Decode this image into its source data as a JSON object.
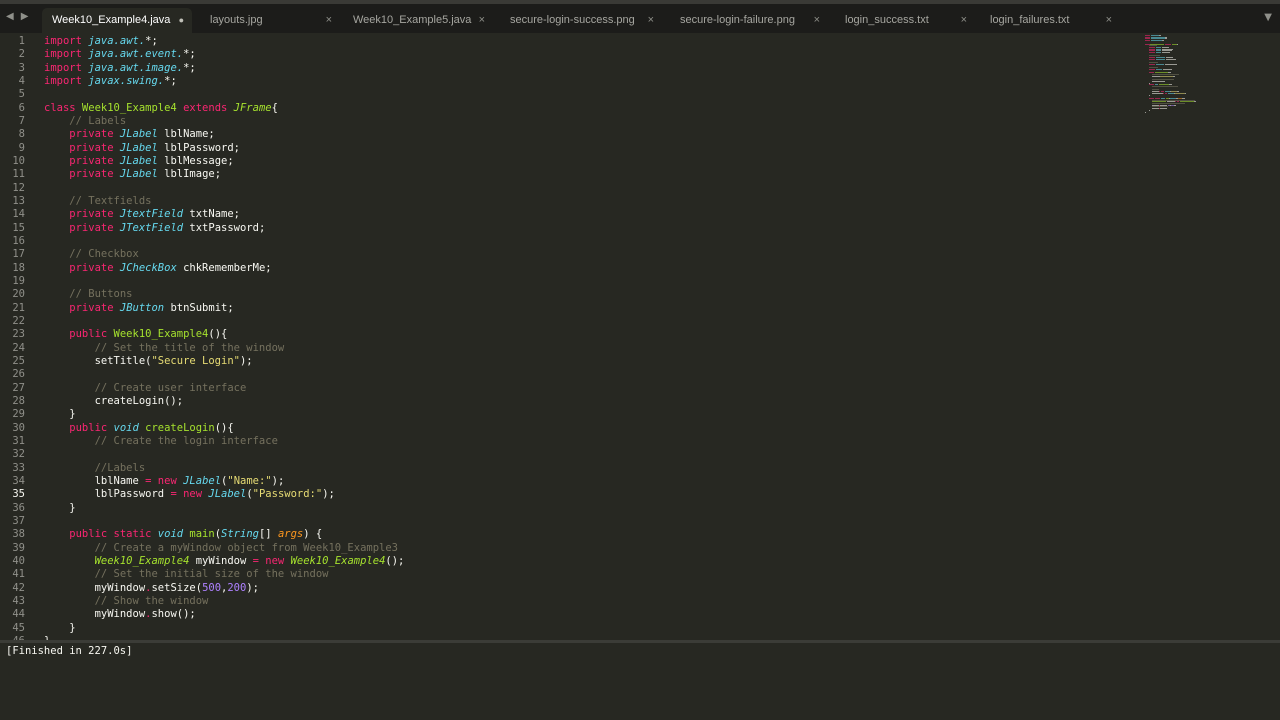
{
  "tabs": [
    {
      "label": "Week10_Example4.java",
      "active": true,
      "modified": true
    },
    {
      "label": "layouts.jpg",
      "active": false,
      "modified": false
    },
    {
      "label": "Week10_Example5.java",
      "active": false,
      "modified": false
    },
    {
      "label": "secure-login-success.png",
      "active": false,
      "modified": false
    },
    {
      "label": "secure-login-failure.png",
      "active": false,
      "modified": false
    },
    {
      "label": "login_success.txt",
      "active": false,
      "modified": false
    },
    {
      "label": "login_failures.txt",
      "active": false,
      "modified": false
    }
  ],
  "icons": {
    "back": "◀",
    "forward": "▶",
    "close": "×",
    "modified": "●",
    "dropdown": "▼"
  },
  "colors": {
    "background": "#272822",
    "keyword": "#f92672",
    "type": "#66d9ef",
    "comment": "#75715e",
    "string": "#e6db74",
    "number": "#ae81ff",
    "function": "#a6e22e",
    "parameter": "#fd971f"
  },
  "editor": {
    "current_line": 35,
    "lines": [
      [
        [
          "k",
          "import"
        ],
        [
          "",
          ""
        ],
        [
          "t",
          " java.awt."
        ],
        [
          "",
          "*;"
        ]
      ],
      [
        [
          "k",
          "import"
        ],
        [
          "t",
          " java.awt.event."
        ],
        [
          "",
          "*;"
        ]
      ],
      [
        [
          "k",
          "import"
        ],
        [
          "t",
          " java.awt.image."
        ],
        [
          "",
          "*;"
        ]
      ],
      [
        [
          "k",
          "import"
        ],
        [
          "t",
          " javax.swing."
        ],
        [
          "",
          "*;"
        ]
      ],
      [],
      [
        [
          "k",
          "class"
        ],
        [
          "f",
          " Week10_Example4"
        ],
        [
          "k",
          " extends"
        ],
        [
          "ti",
          " JFrame"
        ],
        [
          "",
          "{"
        ]
      ],
      [
        [
          "c",
          "    // Labels"
        ]
      ],
      [
        [
          "k",
          "    private"
        ],
        [
          "t",
          " JLabel"
        ],
        [
          "",
          " lblName;"
        ]
      ],
      [
        [
          "k",
          "    private"
        ],
        [
          "t",
          " JLabel"
        ],
        [
          "",
          " lblPassword;"
        ]
      ],
      [
        [
          "k",
          "    private"
        ],
        [
          "t",
          " JLabel"
        ],
        [
          "",
          " lblMessage;"
        ]
      ],
      [
        [
          "k",
          "    private"
        ],
        [
          "t",
          " JLabel"
        ],
        [
          "",
          " lblImage;"
        ]
      ],
      [],
      [
        [
          "c",
          "    // Textfields"
        ]
      ],
      [
        [
          "k",
          "    private"
        ],
        [
          "t",
          " JtextField"
        ],
        [
          "",
          " txtName;"
        ]
      ],
      [
        [
          "k",
          "    private"
        ],
        [
          "t",
          " JTextField"
        ],
        [
          "",
          " txtPassword;"
        ]
      ],
      [],
      [
        [
          "c",
          "    // Checkbox"
        ]
      ],
      [
        [
          "k",
          "    private"
        ],
        [
          "t",
          " JCheckBox"
        ],
        [
          "",
          " chkRememberMe;"
        ]
      ],
      [],
      [
        [
          "c",
          "    // Buttons"
        ]
      ],
      [
        [
          "k",
          "    private"
        ],
        [
          "t",
          " JButton"
        ],
        [
          "",
          " btnSubmit;"
        ]
      ],
      [],
      [
        [
          "k",
          "    public"
        ],
        [
          "f",
          " Week10_Example4"
        ],
        [
          "",
          "(){"
        ]
      ],
      [
        [
          "c",
          "        // Set the title of the window"
        ]
      ],
      [
        [
          "",
          "        setTitle("
        ],
        [
          "s",
          "\"Secure Login\""
        ],
        [
          "",
          ");"
        ]
      ],
      [],
      [
        [
          "c",
          "        // Create user interface"
        ]
      ],
      [
        [
          "",
          "        createLogin();"
        ]
      ],
      [
        [
          "",
          "    }"
        ]
      ],
      [
        [
          "k",
          "    public"
        ],
        [
          "t",
          " void"
        ],
        [
          "f",
          " createLogin"
        ],
        [
          "",
          "(){"
        ]
      ],
      [
        [
          "c",
          "        // Create the login interface"
        ]
      ],
      [],
      [
        [
          "c",
          "        //Labels"
        ]
      ],
      [
        [
          "",
          "        lblName "
        ],
        [
          "k",
          "="
        ],
        [
          "k",
          " new"
        ],
        [
          "t",
          " JLabel"
        ],
        [
          "",
          "("
        ],
        [
          "s",
          "\"Name:\""
        ],
        [
          "",
          ");"
        ]
      ],
      [
        [
          "",
          "        lblPassword "
        ],
        [
          "k",
          "="
        ],
        [
          "k",
          " new"
        ],
        [
          "t",
          " JLabel"
        ],
        [
          "",
          "("
        ],
        [
          "s",
          "\"Password:\""
        ],
        [
          "",
          ");"
        ]
      ],
      [
        [
          "",
          "    }"
        ]
      ],
      [],
      [
        [
          "k",
          "    public"
        ],
        [
          "k",
          " static"
        ],
        [
          "t",
          " void"
        ],
        [
          "f",
          " main"
        ],
        [
          "",
          "("
        ],
        [
          "t",
          "String"
        ],
        [
          "",
          "[] "
        ],
        [
          "p",
          "args"
        ],
        [
          "",
          ") {"
        ]
      ],
      [
        [
          "c",
          "        // Create a myWindow object from Week10_Example3"
        ]
      ],
      [
        [
          "ti",
          "        Week10_Example4"
        ],
        [
          "",
          " myWindow "
        ],
        [
          "k",
          "="
        ],
        [
          "k",
          " new"
        ],
        [
          "ti",
          " Week10_Example4"
        ],
        [
          "",
          "();"
        ]
      ],
      [
        [
          "c",
          "        // Set the initial size of the window"
        ]
      ],
      [
        [
          "",
          "        myWindow"
        ],
        [
          "k",
          "."
        ],
        [
          "",
          "setSize("
        ],
        [
          "n",
          "500"
        ],
        [
          "",
          ","
        ],
        [
          "n",
          "200"
        ],
        [
          "",
          ");"
        ]
      ],
      [
        [
          "c",
          "        // Show the window"
        ]
      ],
      [
        [
          "",
          "        myWindow"
        ],
        [
          "k",
          "."
        ],
        [
          "",
          "show();"
        ]
      ],
      [
        [
          "",
          "    }"
        ]
      ],
      [
        [
          "",
          "}"
        ]
      ]
    ]
  },
  "console": {
    "output": "[Finished in 227.0s]"
  }
}
